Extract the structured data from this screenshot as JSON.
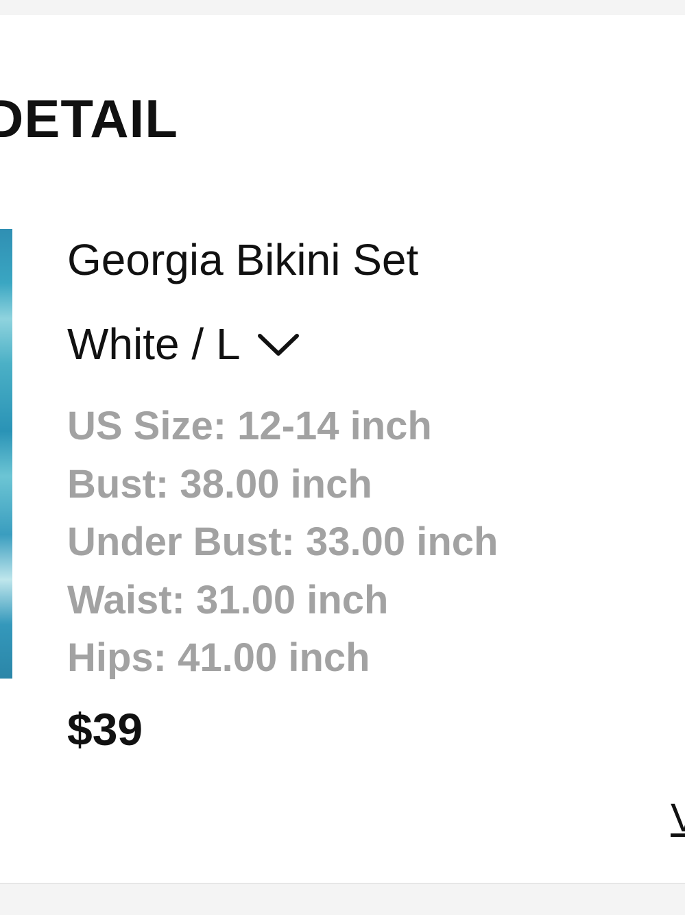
{
  "section": {
    "title": "DETAIL"
  },
  "product": {
    "name": "Georgia Bikini Set",
    "variant": "White / L",
    "specs": [
      "US Size: 12-14 inch",
      "Bust: 38.00 inch",
      "Under Bust: 33.00 inch",
      "Waist: 31.00 inch",
      "Hips: 41.00 inch"
    ],
    "price": "$39"
  },
  "link": {
    "label": "V"
  },
  "icons": {
    "variant_toggle": "chevron-down-icon"
  },
  "colors": {
    "primary_text": "#111111",
    "secondary_text": "#a2a2a2",
    "panel_bg": "#ffffff",
    "page_bg": "#f4f4f4"
  }
}
